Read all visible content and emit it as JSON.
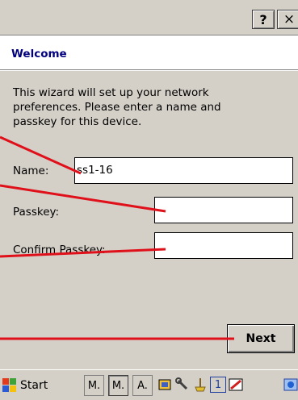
{
  "titlebar": {
    "help_label": "?",
    "close_label": "×"
  },
  "header": {
    "title": "Welcome"
  },
  "wizard": {
    "intro": "This wizard will set up your network preferences. Please enter a name and passkey for this device.",
    "name_label": "Name:",
    "name_value": "ss1-16",
    "passkey_label": "Passkey:",
    "passkey_value": "",
    "confirm_label": "Confirm Passkey:",
    "confirm_value": "",
    "next_label": "Next"
  },
  "taskbar": {
    "start_label": "Start",
    "tasks": [
      "M.",
      "M.",
      "A."
    ],
    "tray_number": "1"
  },
  "colors": {
    "callout": "#e0101a",
    "header_title": "#000080",
    "panel": "#d4d0c8"
  }
}
